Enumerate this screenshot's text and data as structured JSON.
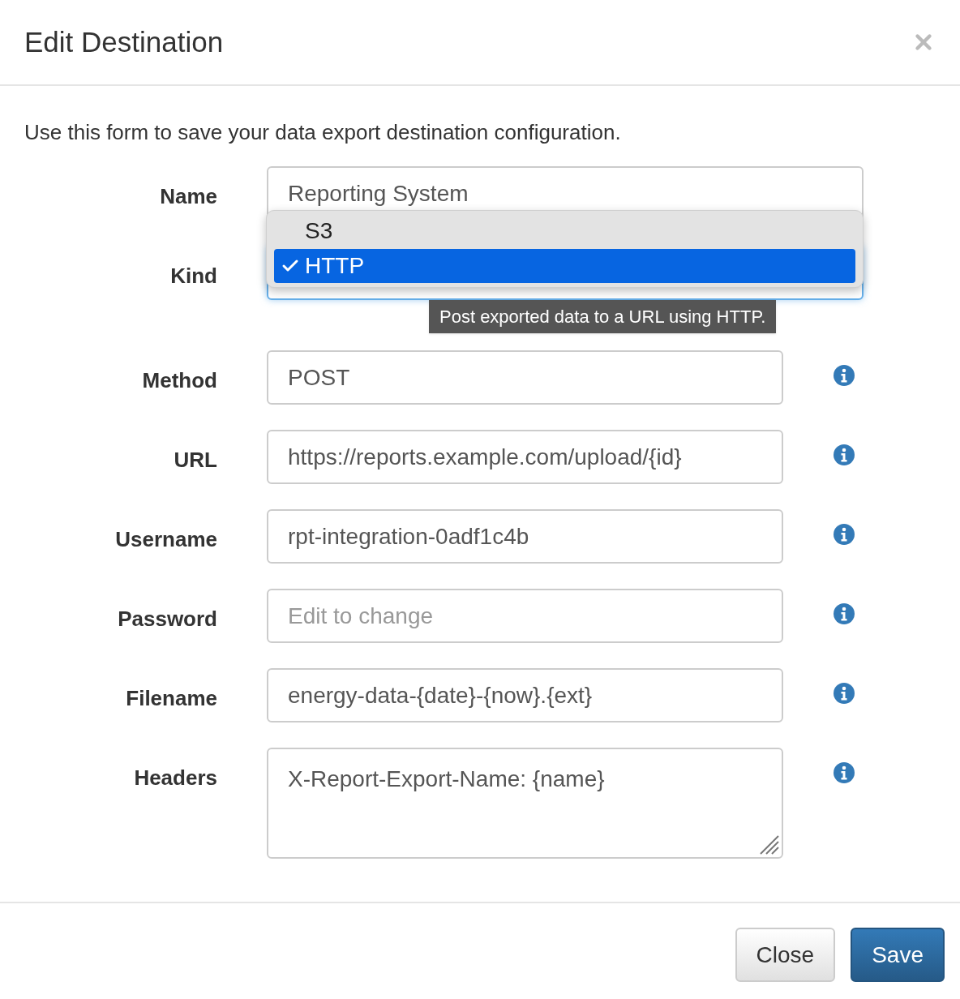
{
  "dialog": {
    "title": "Edit Destination"
  },
  "intro": "Use this form to save your data export destination configuration.",
  "fields": [
    {
      "label": "Name",
      "kind": "text",
      "value": "Reporting System",
      "info": false
    },
    {
      "label": "Kind",
      "kind": "select",
      "options": [
        {
          "label": "S3",
          "selected": false
        },
        {
          "label": "HTTP",
          "selected": true
        }
      ],
      "tooltip": "Post exported data to a URL using HTTP.",
      "info": false
    },
    {
      "label": "Method",
      "kind": "text",
      "value": "POST",
      "info": true
    },
    {
      "label": "URL",
      "kind": "text",
      "value": "https://reports.example.com/upload/{id}",
      "info": true
    },
    {
      "label": "Username",
      "kind": "text",
      "value": "rpt-integration-0adf1c4b",
      "info": true
    },
    {
      "label": "Password",
      "kind": "text",
      "placeholder": "Edit to change",
      "info": true
    },
    {
      "label": "Filename",
      "kind": "text",
      "value": "energy-data-{date}-{now}.{ext}",
      "info": true
    },
    {
      "label": "Headers",
      "kind": "textarea",
      "value": "X-Report-Export-Name: {name}",
      "info": true
    }
  ],
  "buttons": [
    {
      "label": "Close",
      "kind": "secondary"
    },
    {
      "label": "Save",
      "kind": "primary"
    }
  ]
}
